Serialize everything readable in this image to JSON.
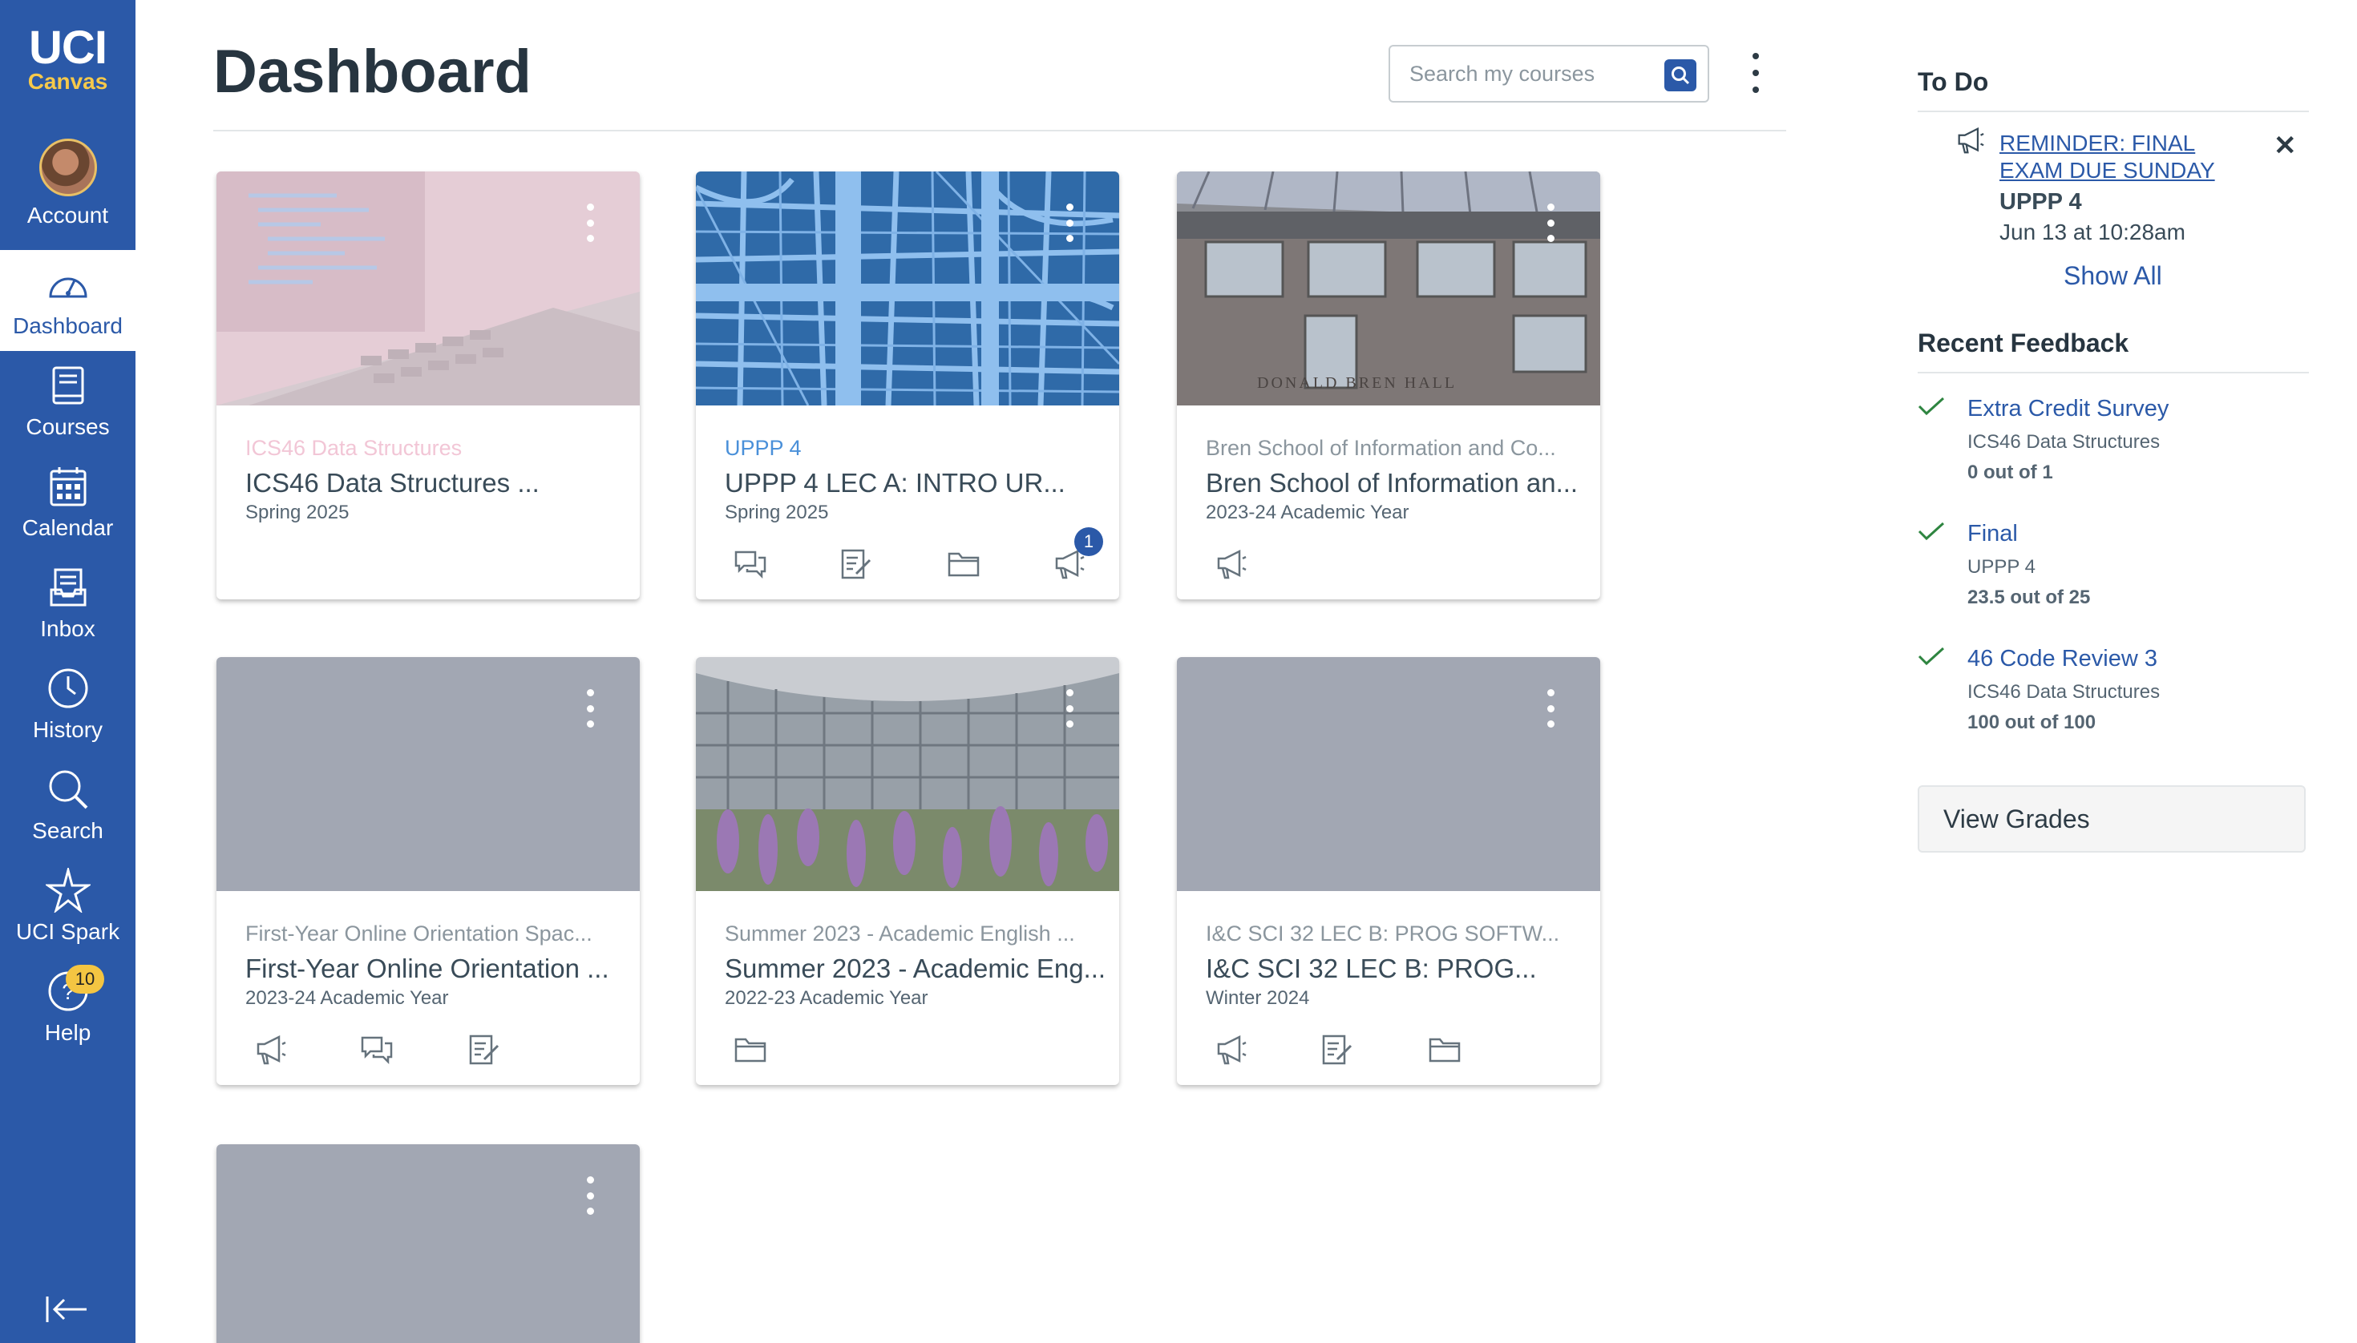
{
  "global_nav": {
    "logo_line1": "UCI",
    "logo_line2": "Canvas",
    "items": [
      {
        "label": "Account"
      },
      {
        "label": "Dashboard"
      },
      {
        "label": "Courses"
      },
      {
        "label": "Calendar"
      },
      {
        "label": "Inbox"
      },
      {
        "label": "History"
      },
      {
        "label": "Search"
      },
      {
        "label": "UCI Spark"
      },
      {
        "label": "Help",
        "badge": "10"
      }
    ]
  },
  "header": {
    "title": "Dashboard",
    "search_placeholder": "Search my courses"
  },
  "cards": [
    {
      "code": "ICS46 Data Structures",
      "name": "ICS46 Data Structures ...",
      "term": "Spring 2025",
      "code_color": "#f2c6d6"
    },
    {
      "code": "UPPP 4",
      "name": "UPPP 4 LEC A: INTRO UR...",
      "term": "Spring 2025",
      "code_color": "#4a90d9",
      "announcement_badge": "1"
    },
    {
      "code": "Bren School of Information and Co...",
      "name": "Bren School of Information an...",
      "term": "2023-24 Academic Year",
      "code_color": "#8b969e"
    },
    {
      "code": "First-Year Online Orientation Spac...",
      "name": "First-Year Online Orientation ...",
      "term": "2023-24 Academic Year",
      "code_color": "#8b969e"
    },
    {
      "code": "Summer 2023 - Academic English ...",
      "name": "Summer 2023 - Academic Eng...",
      "term": "2022-23 Academic Year",
      "code_color": "#8b969e"
    },
    {
      "code": "I&C SCI 32 LEC B: PROG SOFTW...",
      "name": "I&C SCI 32 LEC B: PROG...",
      "term": "Winter 2024",
      "code_color": "#8b969e"
    }
  ],
  "todo": {
    "heading": "To Do",
    "item_title": "REMINDER: FINAL EXAM DUE SUNDAY",
    "item_course": "UPPP 4",
    "item_date": "Jun 13 at 10:28am",
    "show_all": "Show All"
  },
  "recent_feedback": {
    "heading": "Recent Feedback",
    "items": [
      {
        "title": "Extra Credit Survey",
        "course": "ICS46 Data Structures",
        "score": "0 out of 1"
      },
      {
        "title": "Final",
        "course": "UPPP 4",
        "score": "23.5 out of 25"
      },
      {
        "title": "46 Code Review 3",
        "course": "ICS46 Data Structures",
        "score": "100 out of 100"
      }
    ],
    "view_grades": "View Grades"
  }
}
